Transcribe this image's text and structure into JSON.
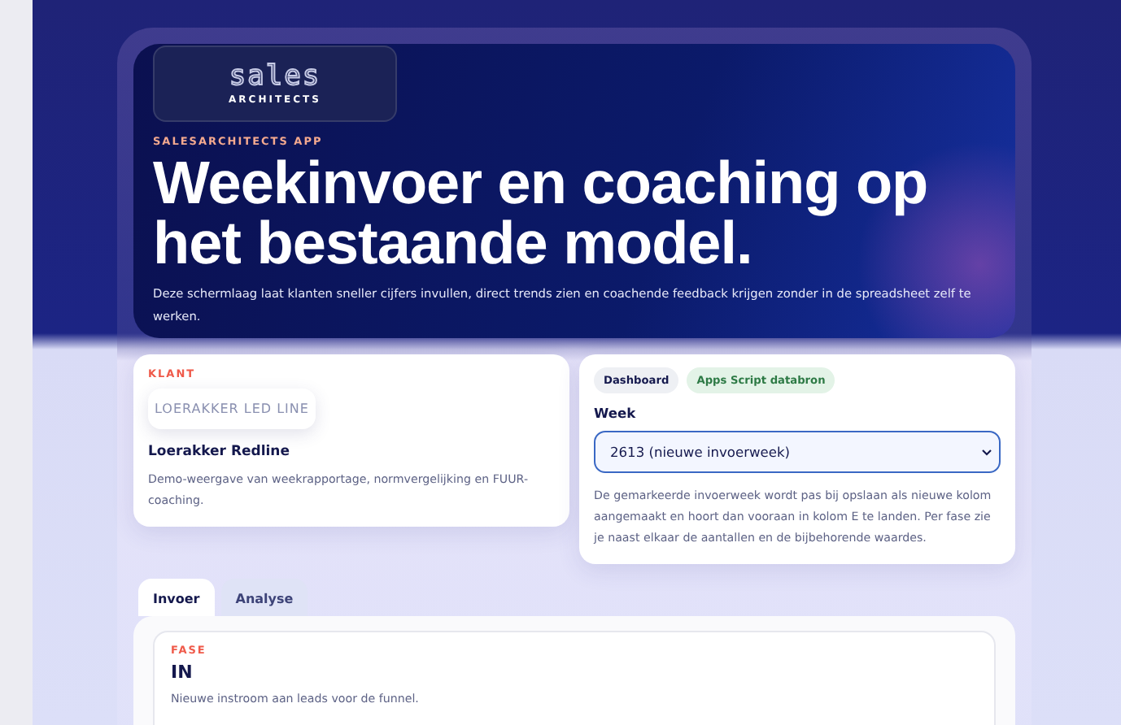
{
  "hero": {
    "logo": {
      "wordmark": "sales",
      "subtitle": "ARCHITECTS"
    },
    "eyebrow": "SALESARCHITECTS APP",
    "title": "Weekinvoer en coaching op het bestaande model.",
    "description": "Deze schermlaag laat klanten sneller cijfers invullen, direct trends zien en coachende feedback krijgen zonder in de spreadsheet zelf te werken."
  },
  "client_card": {
    "eyebrow": "KLANT",
    "logo_text": "LOERAKKER LED LINE",
    "name": "Loerakker Redline",
    "description": "Demo-weergave van weekrapportage, normvergelijking en FUUR-coaching."
  },
  "week_card": {
    "badges": [
      {
        "label": "Dashboard",
        "kind": "neutral"
      },
      {
        "label": "Apps Script databron",
        "kind": "success"
      }
    ],
    "week_label": "Week",
    "week_value": "2613 (nieuwe invoerweek)",
    "note": "De gemarkeerde invoerweek wordt pas bij opslaan als nieuwe kolom aangemaakt en hoort dan vooraan in kolom E te landen. Per fase zie je naast elkaar de aantallen en de bijbehorende waardes."
  },
  "tabs": [
    {
      "label": "Invoer",
      "selected": true
    },
    {
      "label": "Analyse",
      "selected": false
    }
  ],
  "phase": {
    "eyebrow": "FASE",
    "title": "IN",
    "description": "Nieuwe instroom aan leads voor de funnel."
  }
}
